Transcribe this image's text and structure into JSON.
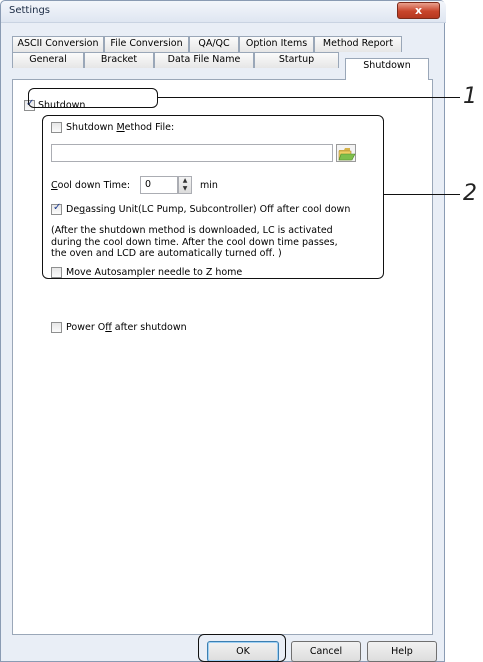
{
  "window": {
    "title": "Settings",
    "close_glyph": "x"
  },
  "tabs_row1": [
    "ASCII Conversion",
    "File Conversion",
    "QA/QC",
    "Option Items",
    "Method Report"
  ],
  "tabs_row2": [
    "General",
    "Bracket",
    "Data File Name",
    "Startup",
    "Shutdown"
  ],
  "active_tab": "Shutdown",
  "shutdown": {
    "shutdown_label": "Shutdown",
    "shutdown_checked": true,
    "method_file": {
      "label_pre": "Shutdown ",
      "label_u": "M",
      "label_post": "ethod File:",
      "checked": false,
      "value": ""
    },
    "cool_down": {
      "label_u": "C",
      "label_post": "ool down Time:",
      "value": "0",
      "unit": "min"
    },
    "degassing": {
      "label_pre": "De",
      "label_u": "g",
      "label_post": "assing Unit(LC Pump, Subcontroller) Off after cool down",
      "checked": true
    },
    "note_lines": [
      "(After the shutdown method is downloaded, LC is activated",
      "during the cool down time. After the cool down time passes,",
      "the oven and LCD are automatically turned off. )"
    ],
    "autosampler": {
      "label": "Move Autosampler needle to Z home",
      "checked": false
    },
    "power_off": {
      "label_pre": "Power O",
      "label_u": "f",
      "label_post": "f after shutdown",
      "checked": false
    }
  },
  "buttons": {
    "ok": "OK",
    "cancel": "Cancel",
    "help": "Help"
  },
  "callouts": {
    "one": "1",
    "two": "2"
  },
  "icons": {
    "folder": "folder-open-icon",
    "close": "close-icon"
  },
  "colors": {
    "close_button": "#c8442b",
    "window_frame": "#e9eef6",
    "check": "#1d3b8f"
  }
}
